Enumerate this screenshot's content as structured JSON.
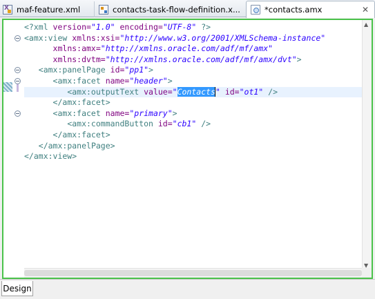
{
  "tabs": [
    {
      "label": "maf-feature.xml",
      "icon": "xml-file-icon"
    },
    {
      "label": "contacts-task-flow-definition.x...",
      "icon": "task-flow-icon"
    },
    {
      "label": "*contacts.amx",
      "icon": "amx-file-icon",
      "active": true
    }
  ],
  "active_tab_close": "✕",
  "code": {
    "l1_a": "<?xml ",
    "l1_b": "version=",
    "l1_c": "\"1.0\"",
    "l1_d": " encoding=",
    "l1_e": "\"UTF-8\"",
    "l1_f": " ?>",
    "l2_a": "<amx:view ",
    "l2_b": "xmlns:xsi=",
    "l2_c": "\"http://www.w3.org/2001/XMLSchema-instance\"",
    "l3_a": "xmlns:amx=",
    "l3_b": "\"http://xmlns.oracle.com/adf/mf/amx\"",
    "l4_a": "xmlns:dvtm=",
    "l4_b": "\"http://xmlns.oracle.com/adf/mf/amx/dvt\"",
    "l4_c": ">",
    "l5_a": "<amx:panelPage ",
    "l5_b": "id=",
    "l5_c": "\"pp1\"",
    "l5_d": ">",
    "l6_a": "<amx:facet ",
    "l6_b": "name=",
    "l6_c": "\"header\"",
    "l6_d": ">",
    "l7_a": "<amx:outputText ",
    "l7_b": "value=",
    "l7_c": "\"",
    "l7_sel": "Contacts",
    "l7_d": "\"",
    "l7_e": " id=",
    "l7_f": "\"ot1\"",
    "l7_g": " />",
    "l8_a": "</amx:facet>",
    "l9_a": "<amx:facet ",
    "l9_b": "name=",
    "l9_c": "\"primary\"",
    "l9_d": ">",
    "l10_a": "<amx:commandButton ",
    "l10_b": "id=",
    "l10_c": "\"cb1\"",
    "l10_d": " />",
    "l11_a": "</amx:facet>",
    "l12_a": "</amx:panelPage>",
    "l13_a": "</amx:view>"
  },
  "bottom_tabs": {
    "design": "Design"
  },
  "colors": {
    "tag": "#3f7f7f",
    "attribute": "#7f007f",
    "value": "#2a00ff",
    "selection": "#3399ff",
    "editor_border": "#4ac24a"
  }
}
